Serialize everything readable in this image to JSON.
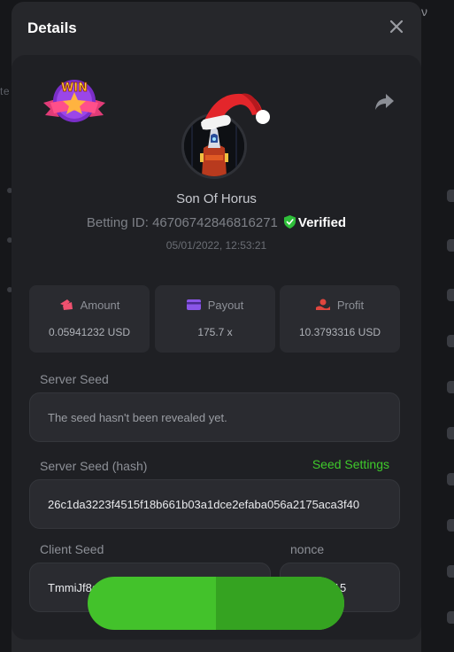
{
  "background": {
    "left_text": "te",
    "top_glyph": "ν"
  },
  "modal": {
    "title": "Details",
    "close_icon": "close-icon",
    "share_icon": "share-icon",
    "win_badge_icon": "win-badge-icon",
    "user": {
      "name": "Son Of Horus",
      "betting_id_label": "Betting ID: 467067428468162​71",
      "verified_label": "Verified",
      "timestamp": "05/01/2022, 12:53:21"
    },
    "stats": [
      {
        "icon": "amount-icon",
        "label": "Amount",
        "value": "0.05941232 USD"
      },
      {
        "icon": "payout-icon",
        "label": "Payout",
        "value": "175.7 x"
      },
      {
        "icon": "profit-icon",
        "label": "Profit",
        "value": "10.3793316 USD"
      }
    ],
    "server_seed": {
      "label": "Server Seed",
      "value": "The seed hasn't been revealed yet."
    },
    "server_seed_hash": {
      "label": "Server Seed (hash)",
      "settings_link": "Seed Settings",
      "value": "26c1da3223f4515f18b661b03a1dce2efaba056a2175aca3f40"
    },
    "client_seed": {
      "label": "Client Seed",
      "value": "TmmiJf8eF8nxjWt"
    },
    "nonce": {
      "label": "nonce",
      "value": "15"
    }
  },
  "colors": {
    "accent_green": "#3fca2b",
    "verified_green": "#2fbf3a",
    "amount_pink": "#f0516f",
    "payout_purple": "#8a55e8",
    "profit_red": "#e0463e"
  }
}
